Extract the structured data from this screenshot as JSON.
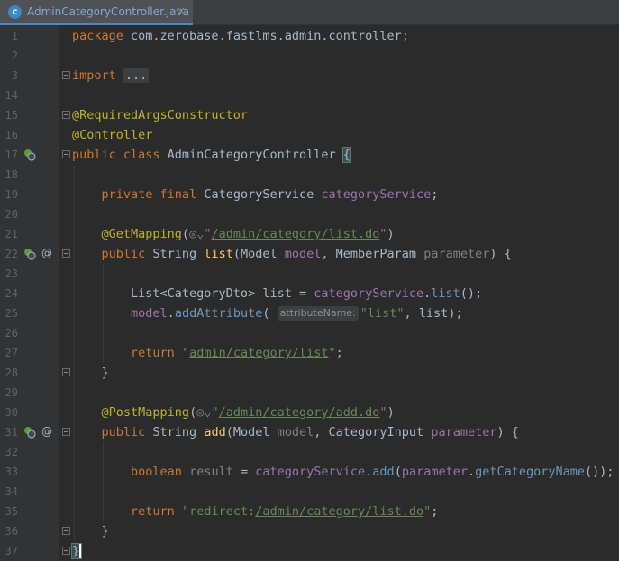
{
  "tab": {
    "label": "AdminCategoryController.java",
    "icon": "c-class-icon",
    "close": "×"
  },
  "lines": [
    {
      "n": "1",
      "t": 0,
      "segs": [
        [
          "kw",
          "package "
        ],
        [
          "",
          "com.zerobase.fastlms.admin.controller;"
        ]
      ]
    },
    {
      "n": "2",
      "t": 1,
      "segs": []
    },
    {
      "n": "3",
      "t": 2,
      "segs": [
        [
          "kw",
          "import "
        ],
        [
          "fold",
          "..."
        ]
      ]
    },
    {
      "n": "14",
      "t": 3,
      "segs": []
    },
    {
      "n": "15",
      "t": 4,
      "segs": [
        [
          "ann",
          "@RequiredArgsConstructor"
        ]
      ]
    },
    {
      "n": "16",
      "t": 5,
      "segs": [
        [
          "ann",
          "@Controller"
        ]
      ]
    },
    {
      "n": "17",
      "t": 6,
      "segs": [
        [
          "kw",
          "public class "
        ],
        [
          "",
          "AdminCategoryController "
        ],
        [
          "brace",
          "{"
        ]
      ]
    },
    {
      "n": "18",
      "t": 7,
      "segs": []
    },
    {
      "n": "19",
      "t": 8,
      "segs": [
        [
          "",
          "    "
        ],
        [
          "kw",
          "private final "
        ],
        [
          "",
          "CategoryService "
        ],
        [
          "fld",
          "categoryService"
        ],
        [
          "",
          ";"
        ]
      ]
    },
    {
      "n": "20",
      "t": 9,
      "segs": []
    },
    {
      "n": "21",
      "t": 10,
      "segs": [
        [
          "",
          "    "
        ],
        [
          "ann",
          "@GetMapping"
        ],
        [
          "",
          "("
        ],
        [
          "dim",
          "◎⌄"
        ],
        [
          "str",
          "\""
        ],
        [
          "strul",
          "/admin/category/list.do"
        ],
        [
          "str",
          "\""
        ],
        [
          "",
          ")"
        ]
      ]
    },
    {
      "n": "22",
      "t": 11,
      "segs": [
        [
          "",
          "    "
        ],
        [
          "kw",
          "public "
        ],
        [
          "",
          "String "
        ],
        [
          "fn",
          "list"
        ],
        [
          "",
          "(Model "
        ],
        [
          "fld",
          "model"
        ],
        [
          "",
          ", MemberParam "
        ],
        [
          "dim",
          "parameter"
        ],
        [
          "",
          ") {"
        ]
      ]
    },
    {
      "n": "23",
      "t": 12,
      "segs": []
    },
    {
      "n": "24",
      "t": 13,
      "segs": [
        [
          "",
          "        List<CategoryDto> list = "
        ],
        [
          "fld",
          "categoryService"
        ],
        [
          "",
          "."
        ],
        [
          "call",
          "list"
        ],
        [
          "",
          "();"
        ]
      ]
    },
    {
      "n": "25",
      "t": 14,
      "segs": [
        [
          "",
          "        "
        ],
        [
          "fld",
          "model"
        ],
        [
          "",
          "."
        ],
        [
          "call",
          "addAttribute"
        ],
        [
          "",
          "( "
        ],
        [
          "hint",
          "attributeName:"
        ],
        [
          "str",
          "\"list\""
        ],
        [
          "",
          ", list);"
        ]
      ]
    },
    {
      "n": "26",
      "t": 15,
      "segs": []
    },
    {
      "n": "27",
      "t": 16,
      "segs": [
        [
          "",
          "        "
        ],
        [
          "kw",
          "return "
        ],
        [
          "str",
          "\""
        ],
        [
          "strul",
          "admin/category/list"
        ],
        [
          "str",
          "\""
        ],
        [
          "",
          ";"
        ]
      ]
    },
    {
      "n": "28",
      "t": 17,
      "segs": [
        [
          "",
          "    }"
        ]
      ]
    },
    {
      "n": "29",
      "t": 18,
      "segs": []
    },
    {
      "n": "30",
      "t": 19,
      "segs": [
        [
          "",
          "    "
        ],
        [
          "ann",
          "@PostMapping"
        ],
        [
          "",
          "("
        ],
        [
          "dim",
          "◎⌄"
        ],
        [
          "str",
          "\""
        ],
        [
          "strul",
          "/admin/category/add.do"
        ],
        [
          "str",
          "\""
        ],
        [
          "",
          ")"
        ]
      ]
    },
    {
      "n": "31",
      "t": 20,
      "segs": [
        [
          "",
          "    "
        ],
        [
          "kw",
          "public "
        ],
        [
          "",
          "String "
        ],
        [
          "fn",
          "add"
        ],
        [
          "",
          "(Model "
        ],
        [
          "dim",
          "model"
        ],
        [
          "",
          ", CategoryInput "
        ],
        [
          "fld",
          "parameter"
        ],
        [
          "",
          ") {"
        ]
      ]
    },
    {
      "n": "32",
      "t": 21,
      "segs": []
    },
    {
      "n": "33",
      "t": 22,
      "segs": [
        [
          "",
          "        "
        ],
        [
          "kw",
          "boolean "
        ],
        [
          "dim",
          "result"
        ],
        [
          "",
          " = "
        ],
        [
          "fld",
          "categoryService"
        ],
        [
          "",
          "."
        ],
        [
          "call",
          "add"
        ],
        [
          "",
          "("
        ],
        [
          "fld",
          "parameter"
        ],
        [
          "",
          "."
        ],
        [
          "call",
          "getCategoryName"
        ],
        [
          "",
          "());"
        ]
      ]
    },
    {
      "n": "34",
      "t": 23,
      "segs": []
    },
    {
      "n": "35",
      "t": 24,
      "segs": [
        [
          "",
          "        "
        ],
        [
          "kw",
          "return "
        ],
        [
          "str",
          "\"redirect:"
        ],
        [
          "strul",
          "/admin/category/list.do"
        ],
        [
          "str",
          "\""
        ],
        [
          "",
          ";"
        ]
      ]
    },
    {
      "n": "36",
      "t": 25,
      "segs": [
        [
          "",
          "    }"
        ]
      ]
    },
    {
      "n": "37",
      "t": 26,
      "segs": [
        [
          "cursor",
          "}"
        ]
      ]
    }
  ],
  "gutter_icons": [
    {
      "line": "17",
      "icons": [
        "spring-bean-icon"
      ]
    },
    {
      "line": "22",
      "icons": [
        "spring-bean-icon",
        "at-icon"
      ]
    },
    {
      "line": "31",
      "icons": [
        "spring-bean-icon",
        "at-icon"
      ]
    }
  ],
  "colors": {
    "background": "#2b2b2b",
    "keyword": "#cc7832",
    "annotation": "#bbb529",
    "string": "#6a8759",
    "field": "#9876aa",
    "method_decl": "#ffc66d",
    "method_call": "#6897bb"
  }
}
